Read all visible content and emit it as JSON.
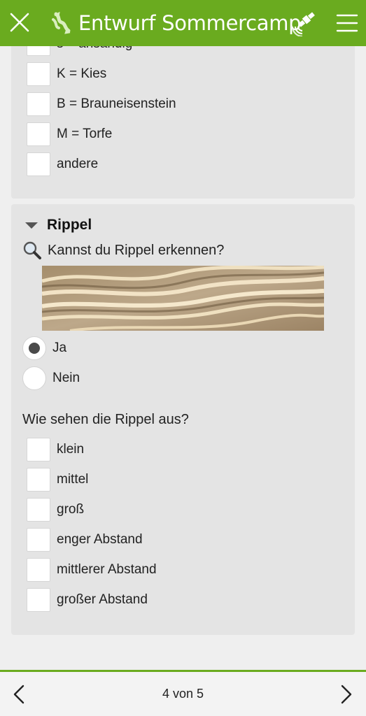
{
  "header": {
    "title": "Entwurf Sommercamp",
    "close_icon": "close-icon",
    "sync_icon": "sync-icon",
    "gps_icon": "gps-satellite-icon",
    "menu_icon": "hamburger-menu-icon",
    "color": "#6aab1f"
  },
  "material": {
    "options": [
      {
        "label": "s = ahsandig",
        "checked": false
      },
      {
        "label": "K = Kies",
        "checked": false
      },
      {
        "label": "B = Brauneisenstein",
        "checked": false
      },
      {
        "label": "M = Torfe",
        "checked": false
      },
      {
        "label": "andere",
        "checked": false
      }
    ]
  },
  "rippel": {
    "title": "Rippel",
    "question1": "Kannst du Rippel erkennen?",
    "radio": [
      {
        "label": "Ja",
        "selected": true
      },
      {
        "label": "Nein",
        "selected": false
      }
    ],
    "question2": "Wie sehen die Rippel aus?",
    "options": [
      {
        "label": "klein",
        "checked": false
      },
      {
        "label": "mittel",
        "checked": false
      },
      {
        "label": "groß",
        "checked": false
      },
      {
        "label": "enger Abstand",
        "checked": false
      },
      {
        "label": "mittlerer Abstand",
        "checked": false
      },
      {
        "label": "großer Abstand",
        "checked": false
      }
    ]
  },
  "footer": {
    "page_indicator": "4 von 5",
    "prev_icon": "chevron-left-icon",
    "next_icon": "chevron-right-icon"
  }
}
